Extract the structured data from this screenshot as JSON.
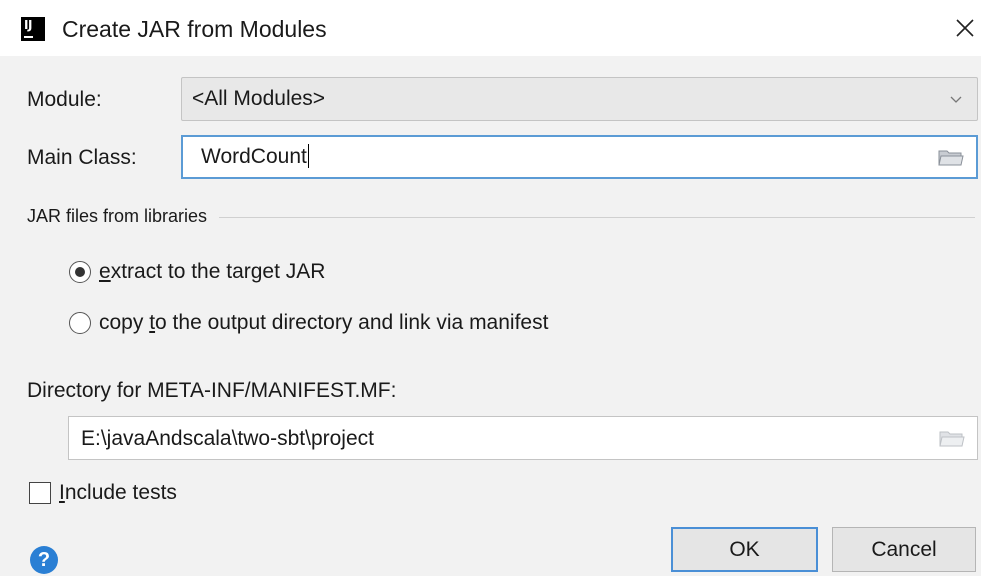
{
  "window": {
    "title": "Create JAR from Modules",
    "icon": "intellij-icon",
    "close_icon": "close-icon"
  },
  "module": {
    "label": "Module:",
    "selected": "<All Modules>"
  },
  "main_class": {
    "label": "Main Class:",
    "value": "WordCount"
  },
  "libraries": {
    "section_title": "JAR files from libraries",
    "options": [
      {
        "prefix": "",
        "mnemonic": "e",
        "rest": "xtract to the target JAR",
        "checked": true
      },
      {
        "prefix": "copy ",
        "mnemonic": "t",
        "rest": "o the output directory and link via manifest",
        "checked": false
      }
    ]
  },
  "manifest": {
    "label": "Directory for META-INF/MANIFEST.MF:",
    "value": "E:\\javaAndscala\\two-sbt\\project"
  },
  "include_tests": {
    "mnemonic": "I",
    "rest": "nclude tests",
    "checked": false
  },
  "buttons": {
    "help": "?",
    "ok": "OK",
    "cancel": "Cancel"
  },
  "colors": {
    "focus_border": "#5b9bd5",
    "dialog_bg": "#f2f2f2",
    "help_blue": "#2a7fd4"
  }
}
